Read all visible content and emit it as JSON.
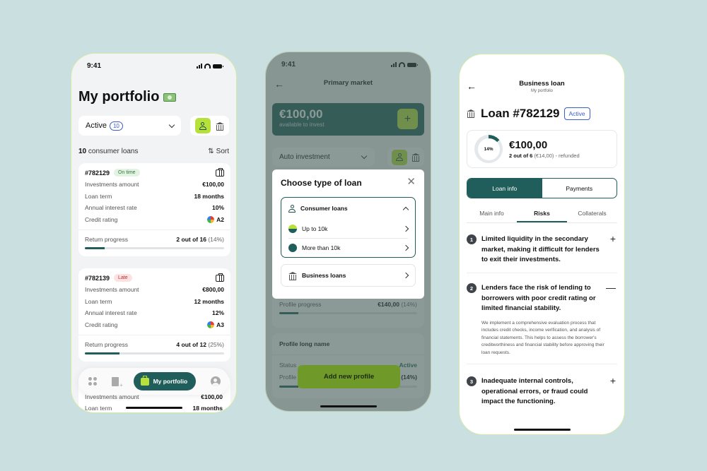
{
  "status_bar": {
    "time": "9:41"
  },
  "portfolio_screen": {
    "title": "My portfolio",
    "filter": {
      "selected": "Active",
      "count": "10"
    },
    "list_header": {
      "count": "10",
      "label": "consumer loans",
      "sort_label": "Sort"
    },
    "loans": [
      {
        "id": "#782129",
        "status": "On time",
        "investments_amount_label": "Investments amount",
        "investments_amount": "€100,00",
        "loan_term_label": "Loan term",
        "loan_term": "18 months",
        "interest_label": "Annual interest rate",
        "interest": "10%",
        "rating_label": "Credit rating",
        "rating": "A2",
        "progress_label": "Return progress",
        "progress_text": "2 out of 16",
        "progress_pct": "(14%)",
        "progress_fraction": 0.14
      },
      {
        "id": "#782139",
        "status": "Late",
        "investments_amount_label": "Investments amount",
        "investments_amount": "€800,00",
        "loan_term_label": "Loan term",
        "loan_term": "12 months",
        "interest_label": "Annual interest rate",
        "interest": "12%",
        "rating_label": "Credit rating",
        "rating": "A3",
        "progress_label": "Return progress",
        "progress_text": "4 out of 12",
        "progress_pct": "(25%)",
        "progress_fraction": 0.25
      }
    ],
    "peek_rows": [
      {
        "label": "Investments amount",
        "value": "€100,00"
      },
      {
        "label": "Loan term",
        "value": "18 months"
      }
    ],
    "nav": {
      "active_label": "My portfolio"
    }
  },
  "market_screen": {
    "title": "Primary market",
    "balance": {
      "amount": "€100,00",
      "label": "available to invest"
    },
    "dropdown": "Auto investment",
    "modal": {
      "title": "Choose type of loan",
      "consumer_label": "Consumer loans",
      "options": [
        "Up to 10k",
        "More than 10k"
      ],
      "business_label": "Business loans"
    },
    "profile_progress": {
      "label": "Profile progress",
      "value": "€140,00",
      "pct": "(14%)",
      "fraction": 0.14
    },
    "profile_card": {
      "name": "Profile long name",
      "status_label": "Status",
      "status": "Active",
      "progress_label": "Profile",
      "pct": "(14%)"
    },
    "add_button": "Add new profile"
  },
  "loan_screen": {
    "title": "Business loan",
    "subtitle": "My portfolio",
    "loan_title": "Loan #782129",
    "badge": "Active",
    "summary": {
      "ring_pct": "14%",
      "ring_fraction": 0.14,
      "amount": "€100,00",
      "progress_bold": "2 out of 6",
      "progress_rest": "(€14,00) - refunded"
    },
    "segments": [
      "Loan info",
      "Payments"
    ],
    "tabs": [
      "Main info",
      "Risks",
      "Collaterals"
    ],
    "risks": [
      {
        "n": "1",
        "title": "Limited liquidity in the secondary market, making it difficult for lenders to exit their investments.",
        "sign": "+"
      },
      {
        "n": "2",
        "title": "Lenders face the risk of lending to borrowers with poor credit rating or limited financial stability.",
        "sign": "—",
        "desc": "We implement a comprehensive evaluation process that includes credit checks, income verification, and analysis of financial statements. This helps to assess the borrower's creditworthiness and financial stability before approving their loan requests."
      },
      {
        "n": "3",
        "title": "Inadequate internal controls, operational errors, or fraud could impact the functioning.",
        "sign": "+"
      }
    ]
  }
}
